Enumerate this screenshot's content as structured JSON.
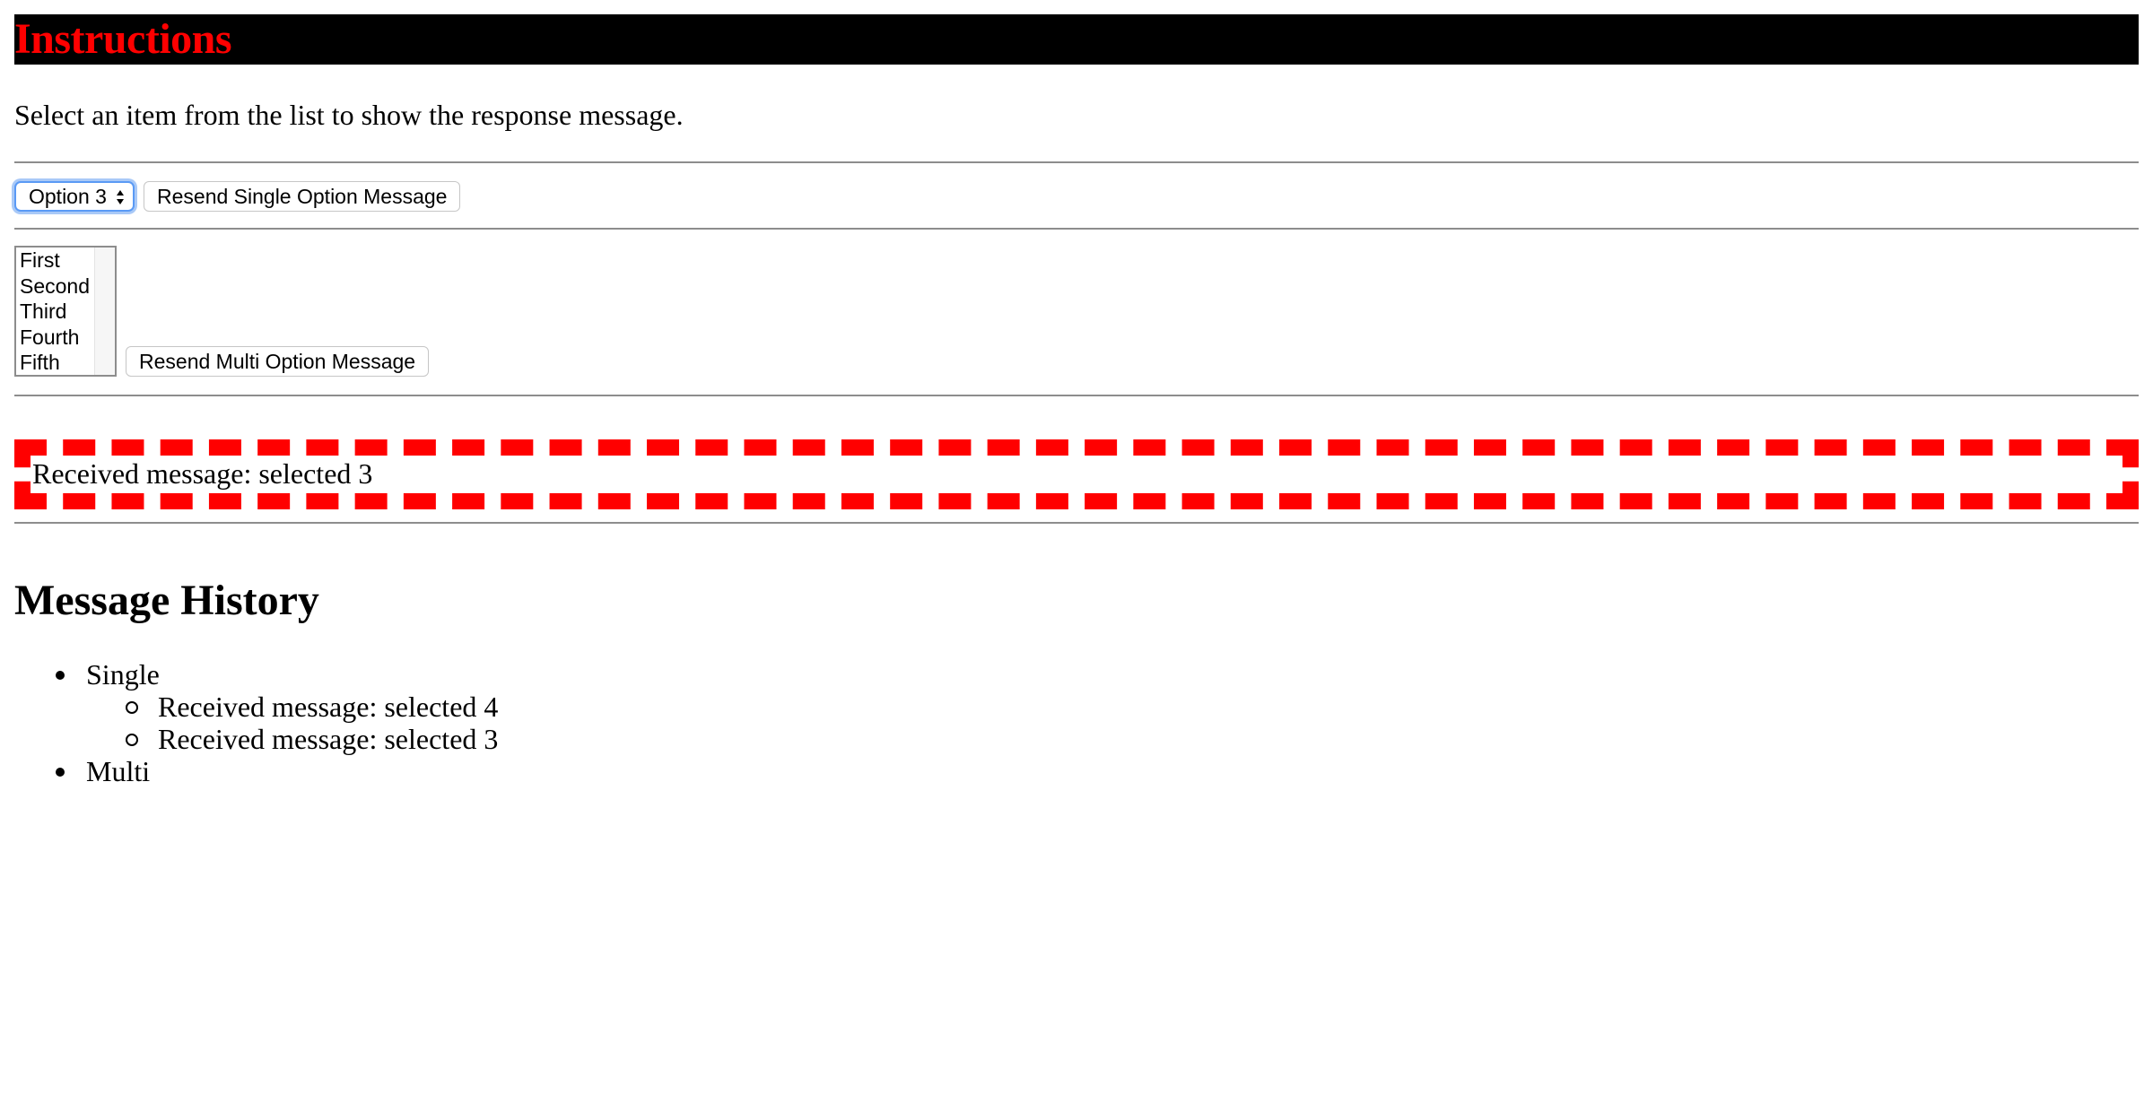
{
  "header": {
    "title": "Instructions",
    "title_color": "#ff0000",
    "bar_color": "#000000"
  },
  "instructions_text": "Select an item from the list to show the response message.",
  "single_select": {
    "selected": "Option 3",
    "resend_label": "Resend Single Option Message"
  },
  "multi_select": {
    "options": [
      "First",
      "Second",
      "Third",
      "Fourth",
      "Fifth"
    ],
    "resend_label": "Resend Multi Option Message"
  },
  "response": {
    "text": "Received message: selected 3",
    "border_color": "#ff0000"
  },
  "history": {
    "title": "Message History",
    "single_label": "Single",
    "single_items": [
      "Received message: selected 4",
      "Received message: selected 3"
    ],
    "multi_label": "Multi"
  }
}
